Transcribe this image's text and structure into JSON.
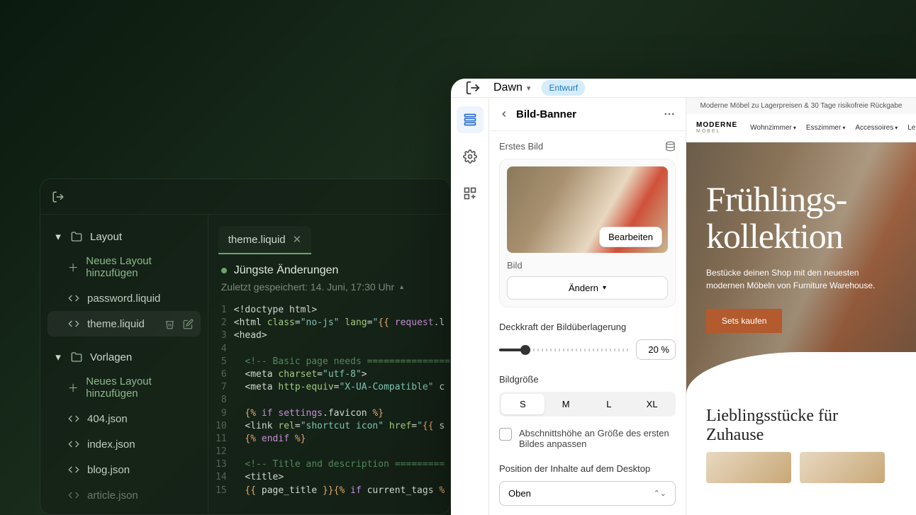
{
  "editor": {
    "sections": {
      "layout": {
        "label": "Layout",
        "add": "Neues Layout hinzufügen",
        "files": [
          "password.liquid",
          "theme.liquid"
        ],
        "active": "theme.liquid"
      },
      "templates": {
        "label": "Vorlagen",
        "add": "Neues Layout hinzufügen",
        "files": [
          "404.json",
          "index.json",
          "blog.json",
          "article.json"
        ]
      }
    },
    "tab": {
      "name": "theme.liquid"
    },
    "changes": {
      "title": "Jüngste Änderungen",
      "saved": "Zuletzt gespeichert: 14. Juni, 17:30 Uhr"
    },
    "code": {
      "lines": [
        {
          "n": 1,
          "html": "<span class='tk-tag'>&lt;!doctype html&gt;</span>"
        },
        {
          "n": 2,
          "html": "<span class='tk-tag'>&lt;html</span> <span class='tk-attr'>class</span>=<span class='tk-str'>\"no-js\"</span> <span class='tk-attr'>lang</span>=<span class='tk-str'>\"</span><span class='tk-liq'>{{</span> <span class='tk-liq2'>request</span>.l"
        },
        {
          "n": 3,
          "html": "<span class='tk-tag'>&lt;head&gt;</span>"
        },
        {
          "n": 4,
          "html": ""
        },
        {
          "n": 5,
          "html": "  <span class='tk-comment'>&lt;!-- Basic page needs ===============</span>"
        },
        {
          "n": 6,
          "html": "  <span class='tk-tag'>&lt;meta</span> <span class='tk-attr'>charset</span>=<span class='tk-str'>\"utf-8\"</span><span class='tk-tag'>&gt;</span>"
        },
        {
          "n": 7,
          "html": "  <span class='tk-tag'>&lt;meta</span> <span class='tk-attr'>http-equiv</span>=<span class='tk-str'>\"X-UA-Compatible\"</span> c"
        },
        {
          "n": 8,
          "html": ""
        },
        {
          "n": 9,
          "html": "  <span class='tk-liq'>{%</span> <span class='tk-liq2'>if</span> <span class='tk-liq2'>settings</span>.favicon <span class='tk-liq'>%}</span>"
        },
        {
          "n": 10,
          "html": "  <span class='tk-tag'>&lt;link</span> <span class='tk-attr'>rel</span>=<span class='tk-str'>\"shortcut icon\"</span> <span class='tk-attr'>href</span>=<span class='tk-str'>\"</span><span class='tk-liq'>{{</span> s"
        },
        {
          "n": 11,
          "html": "  <span class='tk-liq'>{%</span> <span class='tk-liq2'>endif</span> <span class='tk-liq'>%}</span>"
        },
        {
          "n": 12,
          "html": ""
        },
        {
          "n": 13,
          "html": "  <span class='tk-comment'>&lt;!-- Title and description =========</span>"
        },
        {
          "n": 14,
          "html": "  <span class='tk-tag'>&lt;title&gt;</span>"
        },
        {
          "n": 15,
          "html": "  <span class='tk-liq'>{{</span> page_title <span class='tk-liq'>}}{%</span> <span class='tk-liq2'>if</span> current_tags <span class='tk-liq'>%</span>"
        }
      ]
    }
  },
  "theme": {
    "name": "Dawn",
    "badge": "Entwurf",
    "inspector": {
      "title": "Bild-Banner",
      "first_image": "Erstes Bild",
      "image_label": "Bild",
      "edit": "Bearbeiten",
      "change": "Ändern",
      "opacity_label": "Deckkraft der Bildüberlagerung",
      "opacity_value": "20 %",
      "opacity_pct": 20,
      "size_label": "Bildgröße",
      "sizes": [
        "S",
        "M",
        "L",
        "XL"
      ],
      "size_selected": "S",
      "checkbox": "Abschnittshöhe an Größe des ersten Bildes anpassen",
      "position_label": "Position der Inhalte auf dem Desktop",
      "position_value": "Oben"
    },
    "preview": {
      "announce": "Moderne Möbel zu Lagerpreisen & 30 Tage risikofreie Rückgabe",
      "logo_top": "MODERNE",
      "logo_sub": "MÖBEL",
      "nav": [
        "Wohnzimmer",
        "Esszimmer",
        "Accessoires",
        "Le"
      ],
      "hero_title_1": "Frühlings-",
      "hero_title_2": "kollektion",
      "hero_sub": "Bestücke deinen Shop mit den neuesten modernen Möbeln von Furniture Warehouse.",
      "hero_cta": "Sets kaufen",
      "favorites": "Lieblingsstücke für Zuhause"
    }
  }
}
